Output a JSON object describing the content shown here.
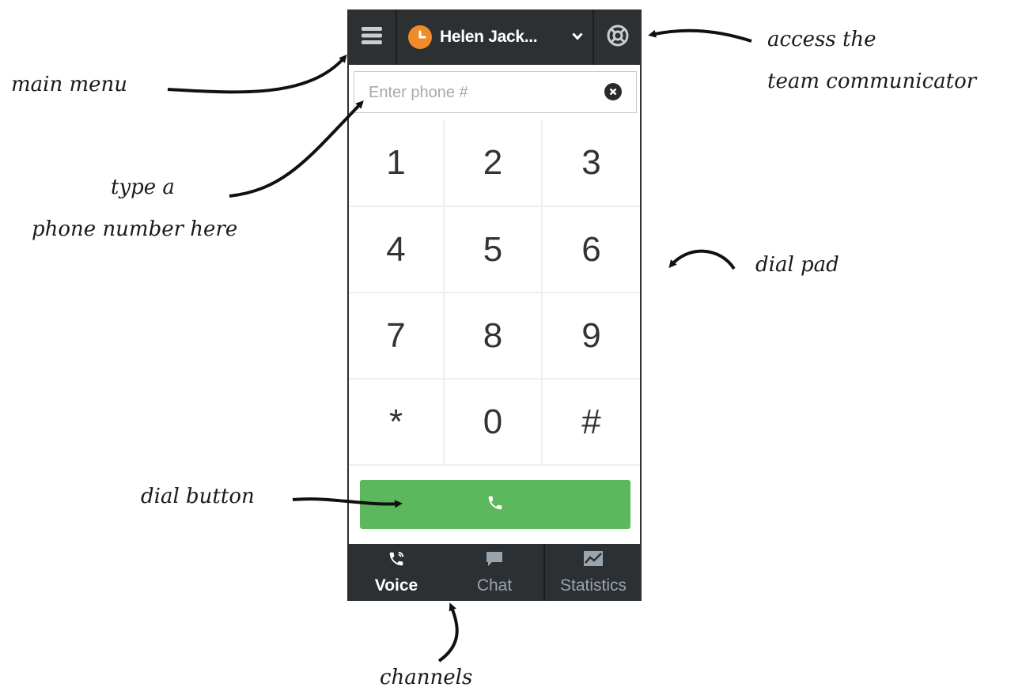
{
  "header": {
    "user_name": "Helen Jack..."
  },
  "dialer": {
    "phone_placeholder": "Enter phone #",
    "keys": [
      "1",
      "2",
      "3",
      "4",
      "5",
      "6",
      "7",
      "8",
      "9",
      "*",
      "0",
      "#"
    ]
  },
  "channels": [
    {
      "label": "Voice",
      "icon": "phone-icon",
      "active": true
    },
    {
      "label": "Chat",
      "icon": "chat-icon",
      "active": false
    },
    {
      "label": "Statistics",
      "icon": "statistics-icon",
      "active": false
    }
  ],
  "annotations": {
    "main_menu": "main menu",
    "access_line1": "access the",
    "access_line2": "team communicator",
    "type_line1": "type a",
    "type_line2": "phone number here",
    "dial_pad": "dial pad",
    "dial_button": "dial button",
    "channels": "channels"
  },
  "colors": {
    "bar_background": "#2c3033",
    "dial_green": "#5cb85c",
    "status_orange": "#f18b2a"
  }
}
